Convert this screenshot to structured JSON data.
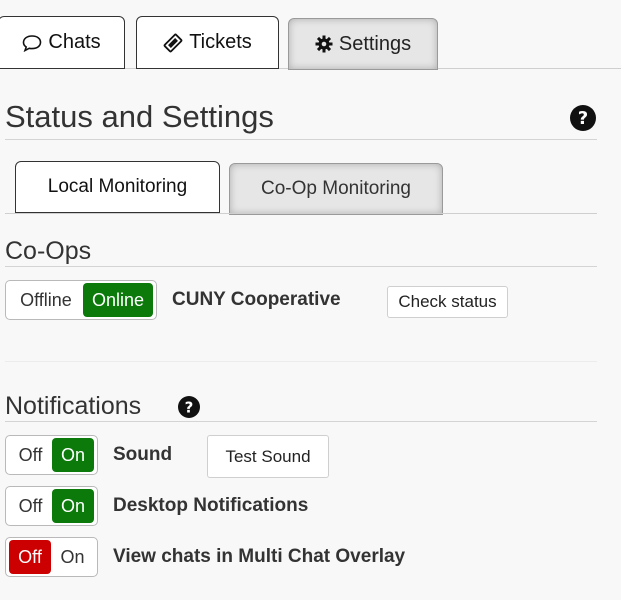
{
  "tabs": {
    "chats": "Chats",
    "tickets": "Tickets",
    "settings": "Settings"
  },
  "page": {
    "title": "Status and Settings"
  },
  "subtabs": {
    "local": "Local Monitoring",
    "coop": "Co-Op Monitoring"
  },
  "coops": {
    "heading": "Co-Ops",
    "toggle": {
      "off_label": "Offline",
      "on_label": "Online",
      "state": "Online"
    },
    "name": "CUNY Cooperative",
    "check_button": "Check status"
  },
  "notifications": {
    "heading": "Notifications",
    "items": [
      {
        "off_label": "Off",
        "on_label": "On",
        "state": "On",
        "label": "Sound",
        "button": "Test Sound"
      },
      {
        "off_label": "Off",
        "on_label": "On",
        "state": "On",
        "label": "Desktop Notifications"
      },
      {
        "off_label": "Off",
        "on_label": "On",
        "state": "Off",
        "label": "View chats in Multi Chat Overlay"
      }
    ]
  },
  "colors": {
    "on": "#0b7a0b",
    "off": "#cc0000"
  }
}
